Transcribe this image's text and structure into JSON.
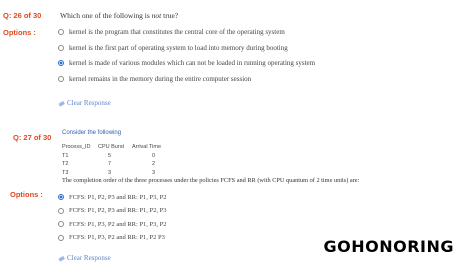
{
  "q1": {
    "number": "Q: 26 of 30",
    "text_prefix": "Which one of the following is ",
    "text_emph": "not",
    "text_suffix": " true?",
    "options_label": "Options :",
    "options": [
      {
        "label": "kernel is the program that constitutes the central core of the operating system",
        "selected": false
      },
      {
        "label": "kernel is the first part of operating system to load into memory during booting",
        "selected": false
      },
      {
        "label": "kernel is made of various modules which can not be loaded in running operating system",
        "selected": true
      },
      {
        "label": "kernel remains in the memory during the entire computer session",
        "selected": false
      }
    ],
    "clear_label": "Clear Response"
  },
  "q2": {
    "number": "Q: 27 of 30",
    "consider": "Consider the following",
    "table": {
      "headers": [
        "Process_ID",
        "CPU Burst",
        "Arrival Time"
      ],
      "rows": [
        [
          "T1",
          "5",
          "0"
        ],
        [
          "T2",
          "7",
          "2"
        ],
        [
          "T3",
          "3",
          "3"
        ]
      ]
    },
    "text": "The completion order of the three processes under the policies FCFS and RR (with CPU quantum of 2 time units) are:",
    "options_label": "Options :",
    "options": [
      {
        "label": "FCFS: P1, P2, P3 and RR: P1, P3, P2",
        "selected": true
      },
      {
        "label": "FCFS: P1, P2, P3 and RR: P1, P2, P3",
        "selected": false
      },
      {
        "label": "FCFS: P1, P3, P2 and RR: P1, P3, P2",
        "selected": false
      },
      {
        "label": "FCFS: P1, P3, P2 and RR: P1, P2 P3",
        "selected": false
      }
    ],
    "clear_label": "Clear Response"
  },
  "watermark": "GOHONORING"
}
